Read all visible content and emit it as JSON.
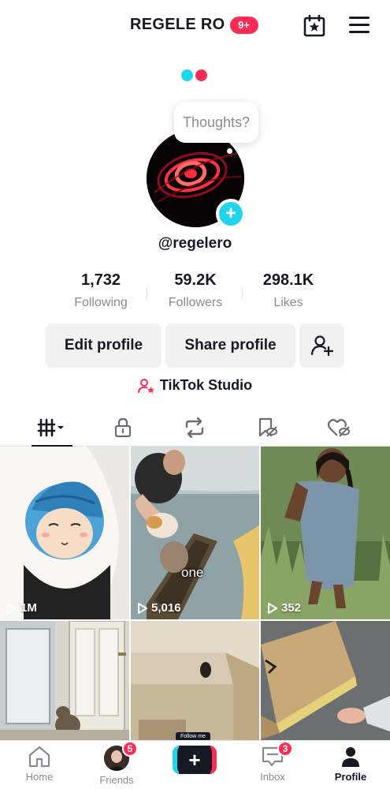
{
  "header": {
    "title": "REGELE RO",
    "notification_badge": "9+"
  },
  "profile": {
    "bubble_text": "Thoughts?",
    "add_icon": "plus-icon",
    "username": "@regelero"
  },
  "stats": [
    {
      "value": "1,732",
      "label": "Following"
    },
    {
      "value": "59.2K",
      "label": "Followers"
    },
    {
      "value": "298.1K",
      "label": "Likes"
    }
  ],
  "buttons": {
    "edit_profile": "Edit profile",
    "share_profile": "Share profile"
  },
  "studio_label": "TikTok Studio",
  "tabs": [
    "videos-grid-icon",
    "lock-icon",
    "repost-icon",
    "favorites-icon",
    "liked-icon"
  ],
  "videos": [
    {
      "views": "1M"
    },
    {
      "views": "5,016",
      "caption": "one"
    },
    {
      "views": "352"
    },
    {
      "views": ""
    },
    {
      "views": "",
      "overlay": "Follow me"
    },
    {
      "views": ""
    }
  ],
  "bottom_nav": {
    "home": "Home",
    "friends": "Friends",
    "friends_badge": "5",
    "inbox": "Inbox",
    "inbox_badge": "3",
    "profile": "Profile",
    "create_icon": "plus-icon"
  },
  "colors": {
    "accent": "#fe2c55",
    "cyan": "#20d5ec",
    "text": "#161823",
    "muted": "#8a8b91"
  }
}
